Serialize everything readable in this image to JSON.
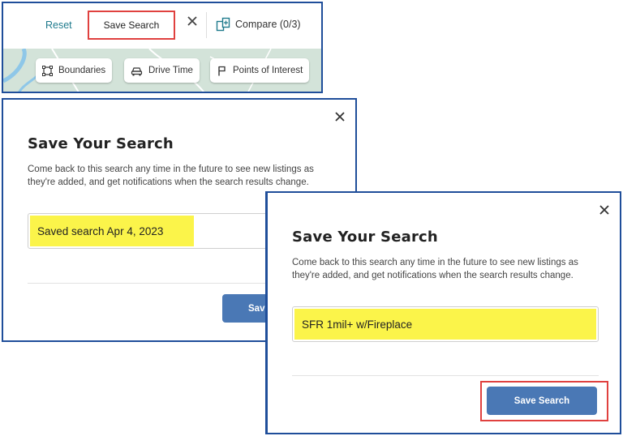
{
  "toolbar": {
    "reset_label": "Reset",
    "save_search_label": "Save Search",
    "compare_label": "Compare (0/3)"
  },
  "map_controls": {
    "boundaries_label": "Boundaries",
    "drive_time_label": "Drive Time",
    "poi_label": "Points of Interest"
  },
  "dialog_1": {
    "title": "Save Your Search",
    "description": "Come back to this search any time in the future to see new listings as they're added, and get notifications when the search results change.",
    "input_value": "Saved search Apr 4, 2023",
    "button_label": "Save"
  },
  "dialog_2": {
    "title": "Save Your Search",
    "description": "Come back to this search any time in the future to see new listings as they're added, and get notifications when the search results change.",
    "input_value": "SFR 1mil+ w/Fireplace",
    "button_label": "Save Search"
  },
  "colors": {
    "panel_border": "#1f4e9a",
    "highlight_red": "#e0413f",
    "highlight_yellow": "#fbf44a",
    "button_blue": "#4a78b5",
    "reset_teal": "#1e7a8c"
  },
  "icons": [
    "close-icon",
    "compare-icon",
    "boundaries-icon",
    "car-icon",
    "flag-icon"
  ]
}
